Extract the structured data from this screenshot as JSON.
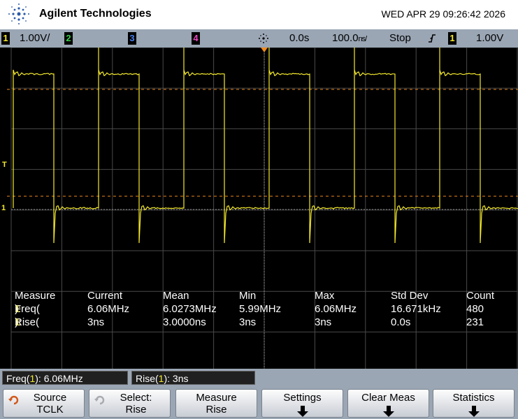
{
  "header": {
    "brand": "Agilent Technologies",
    "datetime": "WED APR 29 09:26:42 2026",
    "logo_icon": "agilent-spark-icon"
  },
  "status_bar": {
    "ch1_num": "1",
    "ch1_scale": "1.00V/",
    "ch2_num": "2",
    "ch3_num": "3",
    "ch4_num": "4",
    "acq_icon": "acquisition-spark-icon",
    "time_delay": "0.0s",
    "time_scale": "100.0̸/",
    "time_scale_text": "100.0",
    "time_scale_unit": "ns/",
    "run_state": "Stop",
    "trigger_icon": "rising-edge-trigger-icon",
    "trig_ch": "1",
    "trig_level": "1.00V"
  },
  "markers": {
    "trigger_level": "T",
    "ch1_ground": "1"
  },
  "measurements": {
    "headers": [
      "Measure",
      "Current",
      "Mean",
      "Min",
      "Max",
      "Std Dev",
      "Count"
    ],
    "rows": [
      {
        "name": "Freq(",
        "ch": "1",
        "close": "):",
        "current": "6.06MHz",
        "mean": "6.0273MHz",
        "min": "5.99MHz",
        "max": "6.06MHz",
        "stddev": "16.671kHz",
        "count": "480"
      },
      {
        "name": "Rise(",
        "ch": "1",
        "close": "):",
        "current": "3ns",
        "mean": "3.0000ns",
        "min": "3ns",
        "max": "3ns",
        "stddev": "0.0s",
        "count": "231"
      }
    ]
  },
  "readouts": {
    "freq_prefix": "Freq(",
    "freq_ch": "1",
    "freq_suffix": "): 6.06MHz",
    "rise_prefix": "Rise(",
    "rise_ch": "1",
    "rise_suffix": "): 3ns"
  },
  "softkeys": {
    "source_line1": "Source",
    "source_line2": "TCLK",
    "select_line1": "Select:",
    "select_line2": "Rise",
    "measure_line1": "Measure",
    "measure_line2": "Rise",
    "settings": "Settings",
    "clear_meas": "Clear Meas",
    "statistics": "Statistics"
  },
  "colors": {
    "trace": "#f5ea2c",
    "graticule": "#5a5a5a",
    "marker_orange": "#f08a1c"
  }
}
